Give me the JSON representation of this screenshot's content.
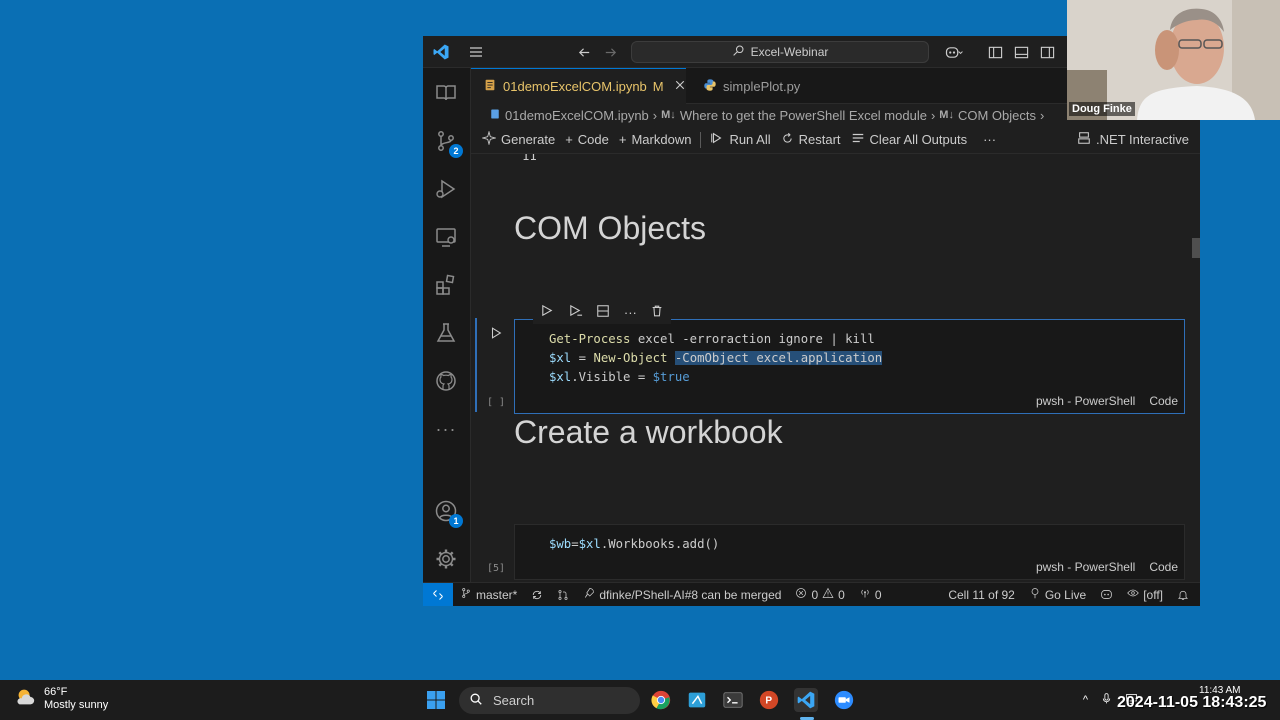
{
  "titlebar": {
    "search": "Excel-Webinar"
  },
  "tabs": [
    {
      "label": "01demoExcelCOM.ipynb",
      "status": "M"
    },
    {
      "label": "simplePlot.py"
    }
  ],
  "breadcrumbs": {
    "file": "01demoExcelCOM.ipynb",
    "items": [
      "Where to get the PowerShell Excel module",
      "COM Objects"
    ],
    "md_prefix": "M↓"
  },
  "toolbar": {
    "generate": "Generate",
    "code": "Code",
    "markdown": "Markdown",
    "run_all": "Run All",
    "restart": "Restart",
    "clear_outputs": "Clear All Outputs",
    "more": "···",
    "kernel": ".NET Interactive"
  },
  "editor": {
    "prev_output_fragment": "11",
    "heading1": "COM Objects",
    "cell1": {
      "exec_count": "[ ]",
      "lines": {
        "l1a": "Get-Process",
        "l1b": " excel -erroraction ignore | kill",
        "l2a": "$xl",
        "l2b": " = ",
        "l2c": "New-Object",
        "l2d": " ",
        "l2e": "-ComObject excel.application",
        "l3a": "$xl",
        "l3b": ".Visible = ",
        "l3c": "$true"
      },
      "lang": "pwsh - PowerShell",
      "type": "Code"
    },
    "heading2": "Create a workbook",
    "cell2": {
      "exec_count": "[5]",
      "lines": {
        "l1a": "$wb",
        "l1b": "=",
        "l1c": "$xl",
        "l1d": ".Workbooks.add()"
      },
      "lang": "pwsh - PowerShell",
      "type": "Code"
    }
  },
  "activity_badges": {
    "scm": "2",
    "accounts": "1"
  },
  "statusbar": {
    "branch": "master*",
    "pr": "dfinke/PShell-AI#8 can be merged",
    "errors": "0",
    "warnings": "0",
    "ports": "0",
    "cell": "Cell 11 of 92",
    "golive": "Go Live",
    "copilot_state": "[off]"
  },
  "webcam": {
    "name": "Doug Finke"
  },
  "taskbar": {
    "weather_temp": "66°F",
    "weather_desc": "Mostly sunny",
    "search": "Search",
    "clock": "11:43 AM"
  },
  "timestamp": "2024-11-05 18:43:25",
  "colors": {
    "desktop": "#0a6fb4",
    "accent": "#0078d4",
    "modified_tab": "#e8c46a",
    "selection": "#264f78"
  }
}
